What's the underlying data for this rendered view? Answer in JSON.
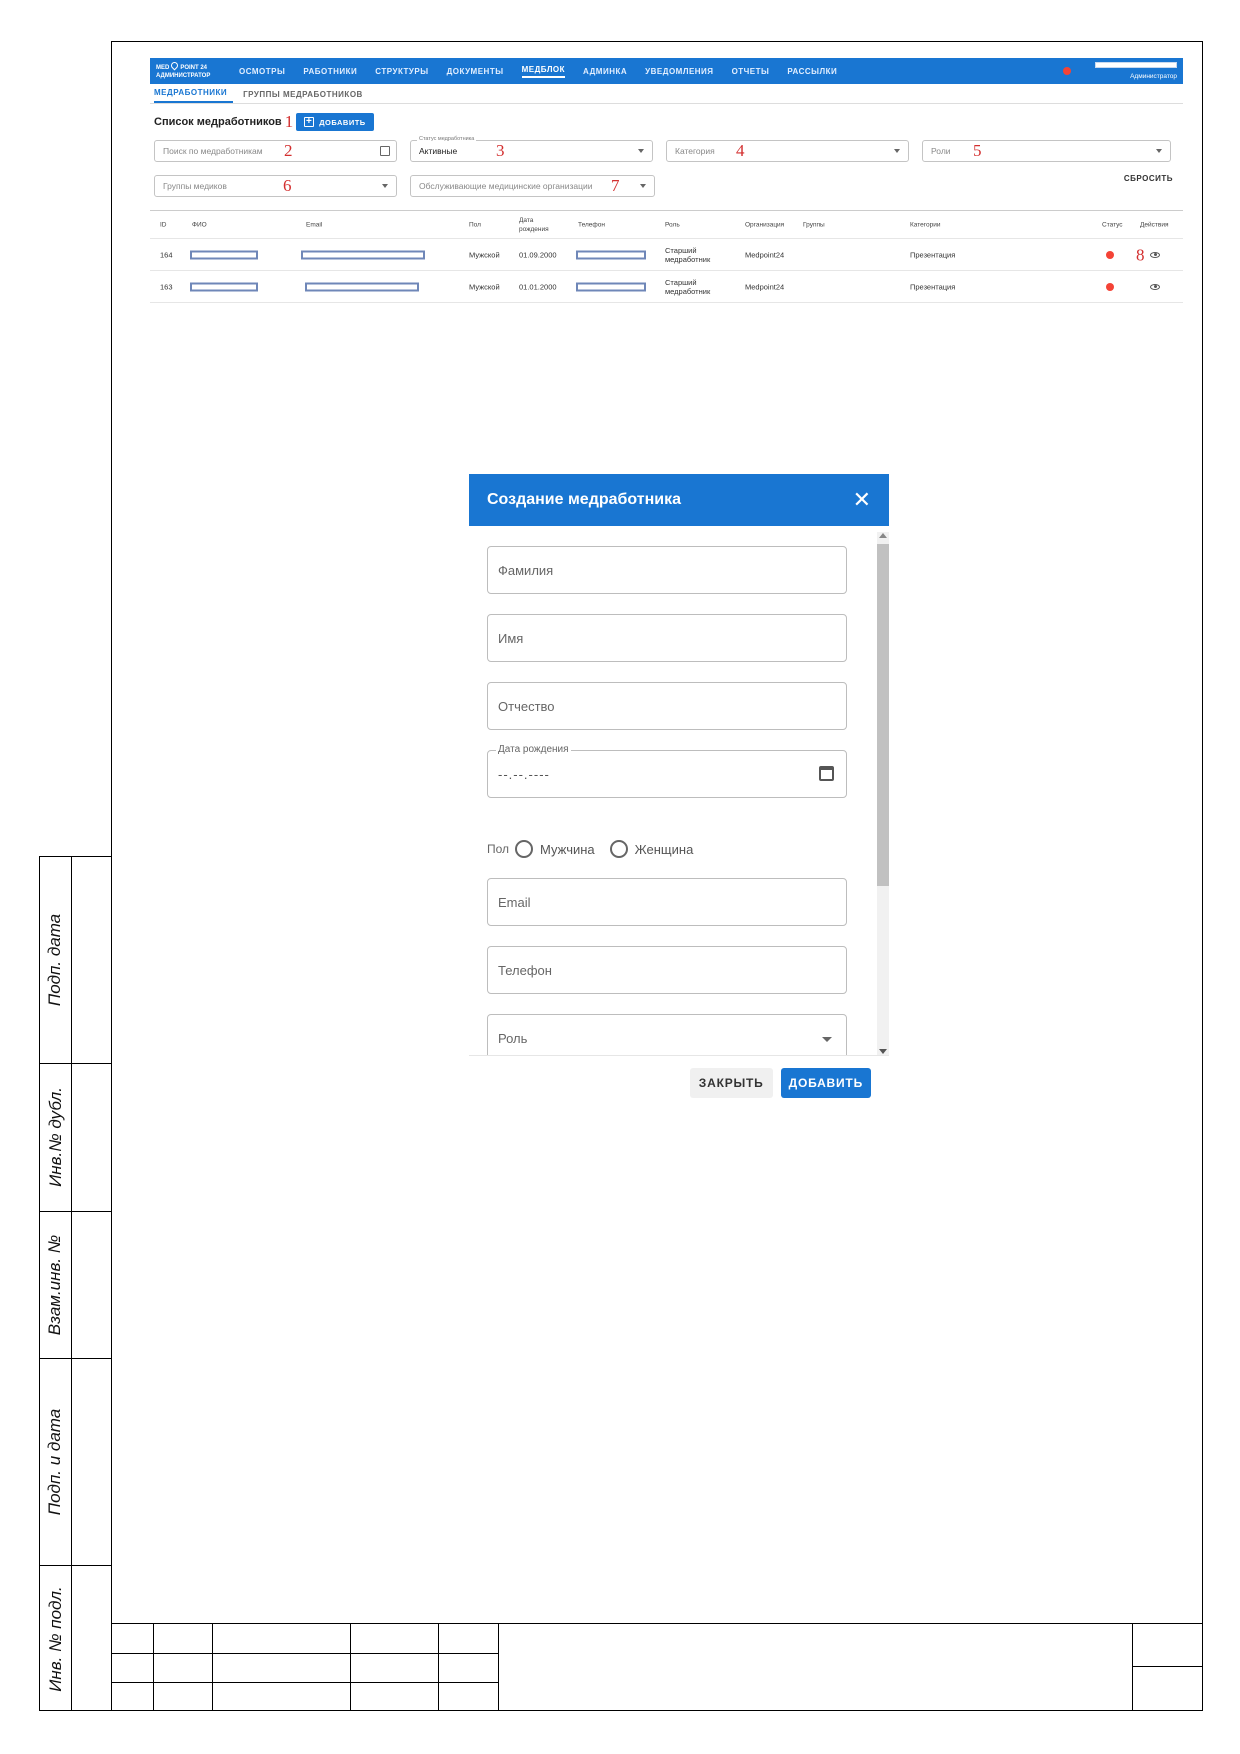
{
  "nav": {
    "logo_line1": "MED",
    "logo_line1b": "POINT 24",
    "logo_line2": "АДМИНИСТРАТОР",
    "items": [
      "ОСМОТРЫ",
      "РАБОТНИКИ",
      "СТРУКТУРЫ",
      "ДОКУМЕНТЫ",
      "МЕДБЛОК",
      "АДМИНКА",
      "УВЕДОМЛЕНИЯ",
      "ОТЧЕТЫ",
      "РАССЫЛКИ"
    ],
    "active": "МЕДБЛОК",
    "user_role": "Администратор"
  },
  "subtabs": [
    "МЕДРАБОТНИКИ",
    "ГРУППЫ МЕДРАБОТНИКОВ"
  ],
  "list": {
    "title": "Список медработников",
    "add_label": "ДОБАВИТЬ"
  },
  "callouts": [
    "1",
    "2",
    "3",
    "4",
    "5",
    "6",
    "7",
    "8"
  ],
  "filters": {
    "search_placeholder": "Поиск по медработникам",
    "status_legend": "Статус медработника",
    "status_value": "Активные",
    "category_placeholder": "Категория",
    "roles_placeholder": "Роли",
    "groups_placeholder": "Группы медиков",
    "orgs_placeholder": "Обслуживающие медицинские организации",
    "reset_label": "СБРОСИТЬ"
  },
  "table": {
    "headers": {
      "id": "ID",
      "fio": "ФИО",
      "email": "Email",
      "gender": "Пол",
      "birth": "Дата рождения",
      "phone": "Телефон",
      "role": "Роль",
      "org": "Организация",
      "groups": "Группы",
      "categories": "Категории",
      "status": "Статус",
      "actions": "Действия"
    },
    "rows": [
      {
        "id": "164",
        "gender": "Мужской",
        "birth": "01.09.2000",
        "role": "Старший медработник",
        "org": "Medpoint24",
        "category": "Презентация"
      },
      {
        "id": "163",
        "gender": "Мужской",
        "birth": "01.01.2000",
        "role": "Старший медработник",
        "org": "Medpoint24",
        "category": "Презентация"
      }
    ],
    "status_color": "#f44336"
  },
  "modal": {
    "title": "Создание медработника",
    "close_glyph": "✕",
    "fields": {
      "last_name": "Фамилия",
      "first_name": "Имя",
      "patronymic": "Отчество",
      "birth_legend": "Дата рождения",
      "birth_value": "--.--.----",
      "gender_label": "Пол",
      "male": "Мужчина",
      "female": "Женщина",
      "email": "Email",
      "phone": "Телефон",
      "role": "Роль"
    },
    "close_button": "ЗАКРЫТЬ",
    "add_button": "ДОБАВИТЬ"
  },
  "frame": {
    "side_labels": [
      "Подп. дата",
      "Инв.№ дубл.",
      "Взам.инв. №",
      "Подп. и дата",
      "Инв. № подл."
    ]
  },
  "colors": {
    "primary": "#1976d2",
    "callout": "#d32f2f",
    "redaction": "#6f87b8"
  }
}
